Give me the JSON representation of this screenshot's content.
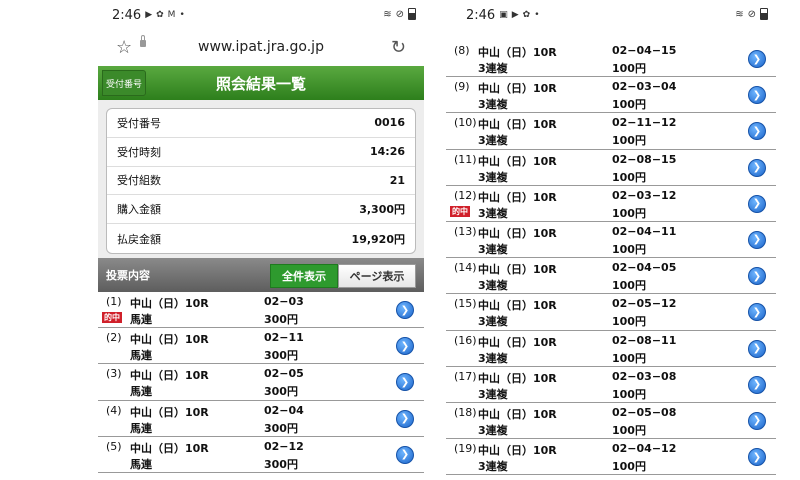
{
  "left": {
    "status": {
      "time": "2:46"
    },
    "browser": {
      "url": "www.ipat.jra.go.jp"
    },
    "header": {
      "title": "照会結果一覧",
      "back_label": "受付番号"
    },
    "summary": [
      {
        "label": "受付番号",
        "value": "0016"
      },
      {
        "label": "受付時刻",
        "value": "14:26"
      },
      {
        "label": "受付組数",
        "value": "21"
      },
      {
        "label": "購入金額",
        "value": "3,300円"
      },
      {
        "label": "払戻金額",
        "value": "19,920円"
      }
    ],
    "section": {
      "title": "投票内容",
      "tab_all": "全件表示",
      "tab_page": "ページ表示"
    },
    "bets": [
      {
        "num": "(1)",
        "race": "中山（日）10R",
        "type": "馬連",
        "combo": "02−03",
        "amount": "300円",
        "hit": "的中"
      },
      {
        "num": "(2)",
        "race": "中山（日）10R",
        "type": "馬連",
        "combo": "02−11",
        "amount": "300円"
      },
      {
        "num": "(3)",
        "race": "中山（日）10R",
        "type": "馬連",
        "combo": "02−05",
        "amount": "300円"
      },
      {
        "num": "(4)",
        "race": "中山（日）10R",
        "type": "馬連",
        "combo": "02−04",
        "amount": "300円"
      },
      {
        "num": "(5)",
        "race": "中山（日）10R",
        "type": "馬連",
        "combo": "02−12",
        "amount": "300円"
      }
    ]
  },
  "right": {
    "status": {
      "time": "2:46"
    },
    "bets": [
      {
        "num": "(8)",
        "race": "中山（日）10R",
        "type": "3連複",
        "combo": "02−04−15",
        "amount": "100円"
      },
      {
        "num": "(9)",
        "race": "中山（日）10R",
        "type": "3連複",
        "combo": "02−03−04",
        "amount": "100円"
      },
      {
        "num": "(10)",
        "race": "中山（日）10R",
        "type": "3連複",
        "combo": "02−11−12",
        "amount": "100円"
      },
      {
        "num": "(11)",
        "race": "中山（日）10R",
        "type": "3連複",
        "combo": "02−08−15",
        "amount": "100円"
      },
      {
        "num": "(12)",
        "race": "中山（日）10R",
        "type": "3連複",
        "combo": "02−03−12",
        "amount": "100円",
        "hit": "的中"
      },
      {
        "num": "(13)",
        "race": "中山（日）10R",
        "type": "3連複",
        "combo": "02−04−11",
        "amount": "100円"
      },
      {
        "num": "(14)",
        "race": "中山（日）10R",
        "type": "3連複",
        "combo": "02−04−05",
        "amount": "100円"
      },
      {
        "num": "(15)",
        "race": "中山（日）10R",
        "type": "3連複",
        "combo": "02−05−12",
        "amount": "100円"
      },
      {
        "num": "(16)",
        "race": "中山（日）10R",
        "type": "3連複",
        "combo": "02−08−11",
        "amount": "100円"
      },
      {
        "num": "(17)",
        "race": "中山（日）10R",
        "type": "3連複",
        "combo": "02−03−08",
        "amount": "100円"
      },
      {
        "num": "(18)",
        "race": "中山（日）10R",
        "type": "3連複",
        "combo": "02−05−08",
        "amount": "100円"
      },
      {
        "num": "(19)",
        "race": "中山（日）10R",
        "type": "3連複",
        "combo": "02−04−12",
        "amount": "100円"
      }
    ]
  },
  "icons": {
    "arrow": "chevron-right-circle-icon",
    "star": "star-icon",
    "reload": "reload-icon"
  },
  "colors": {
    "header_green": "#3b8a2a",
    "hit_red": "#d0202a",
    "arrow_blue": "#1a63c9"
  }
}
